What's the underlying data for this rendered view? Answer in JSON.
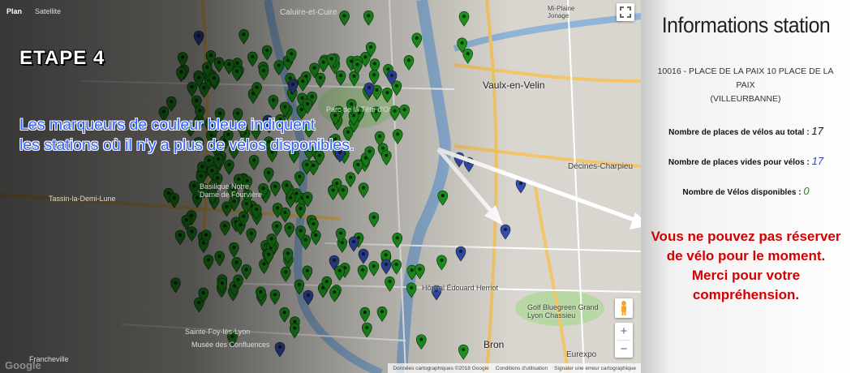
{
  "map": {
    "type_tabs": [
      "Plan",
      "Satellite"
    ],
    "place_labels": [
      {
        "text": "Caluire-et-Cuire"
      },
      {
        "text": "Vaulx-en-Velin"
      },
      {
        "text": "Mi-Plaine Jonage"
      },
      {
        "text": "Décines-Charpieu"
      },
      {
        "text": "Tassin-la-Demi-Lune"
      },
      {
        "text": "Sainte-Foy-lès-Lyon"
      },
      {
        "text": "Musée des Confluences"
      },
      {
        "text": "Parc de la Tête d'Or"
      },
      {
        "text": "Hôpital Édouard Herriot"
      },
      {
        "text": "Golf Bluegreen Grand Lyon Chassieu"
      },
      {
        "text": "Eurexpo"
      },
      {
        "text": "Bron"
      },
      {
        "text": "Basilique Notre Dame de Fourvière"
      },
      {
        "text": "Francheville"
      }
    ],
    "step_title": "ETAPE 4",
    "caption_line1": "Les marqueurs de couleur bleue indiquent",
    "caption_line2": "les stations où il n'y a plus de vélos disponibles.",
    "footer_copyright": "Données cartographiques ©2018 Google",
    "footer_terms": "Conditions d'utilisation",
    "footer_report": "Signaler une erreur cartographique",
    "google_logo": "Google",
    "zoom_in": "+",
    "zoom_out": "−",
    "fullscreen_icon": "fullscreen-icon",
    "pegman_icon": "pegman-icon",
    "marker_colors": {
      "available": "#1f9e1f",
      "empty": "#3848b8"
    },
    "arrow_color": "#ffffff"
  },
  "panel": {
    "title": "Informations station",
    "station_line1": "10016 - PLACE DE LA PAIX 10 PLACE DE LA PAIX",
    "station_line2": "(VILLEURBANNE)",
    "total_label": "Nombre de places de vélos au total : ",
    "total_value": "17",
    "free_label": "Nombre de places vides pour vélos : ",
    "free_value": "17",
    "bikes_label": "Nombre de Vélos disponibles : ",
    "bikes_value": "0",
    "message": "Vous ne pouvez pas réserver de vélo pour le moment. Merci pour votre compréhension.",
    "colors": {
      "total": "#111111",
      "free": "#3848b8",
      "bikes": "#1f8a1f",
      "message": "#d40000"
    }
  }
}
